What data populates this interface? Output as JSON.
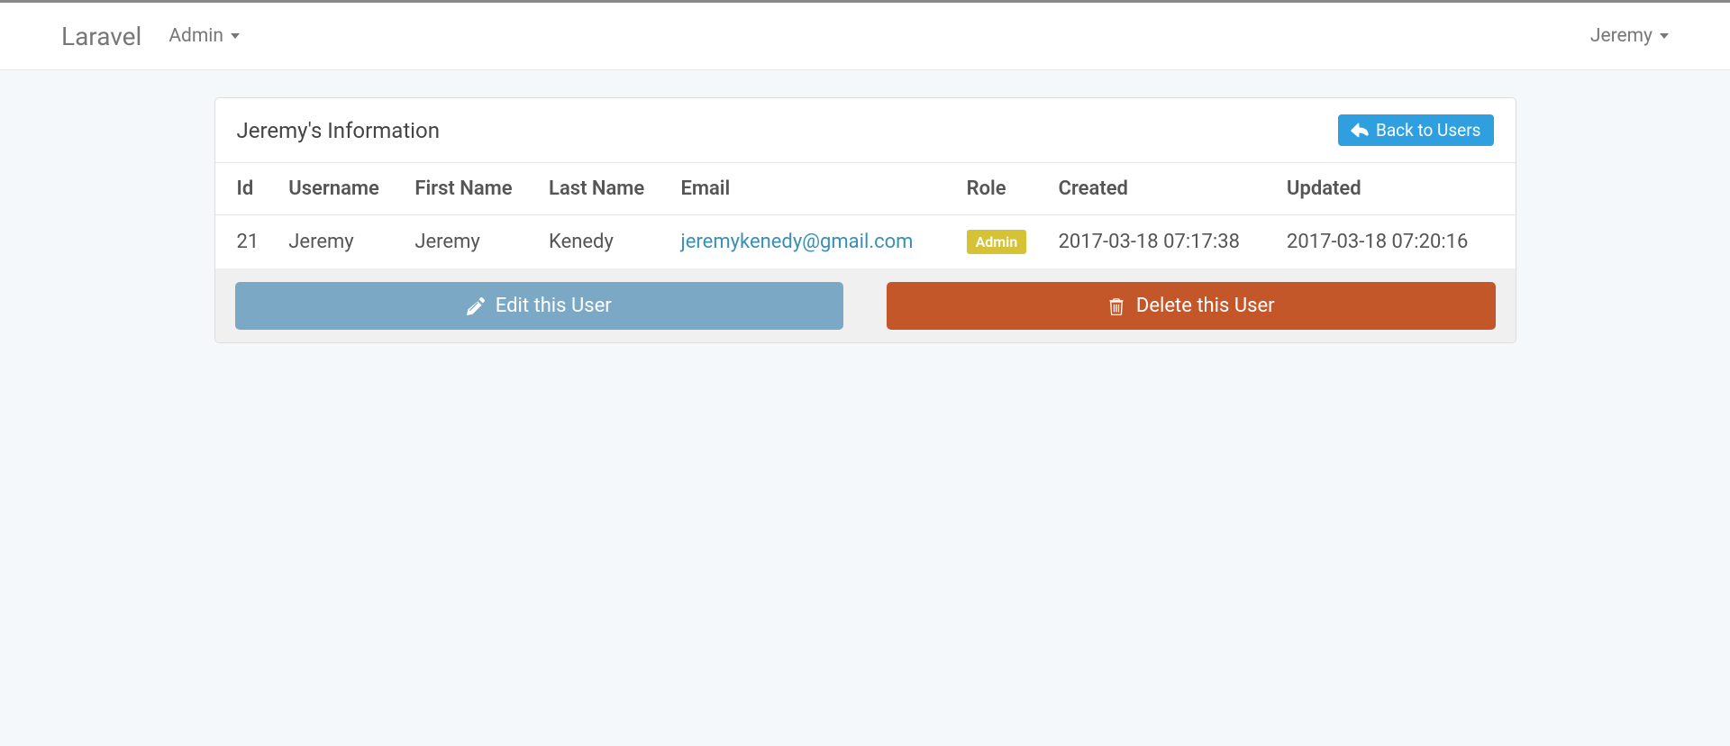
{
  "navbar": {
    "brand": "Laravel",
    "admin_label": "Admin",
    "user_label": "Jeremy"
  },
  "panel": {
    "title": "Jeremy's Information",
    "back_button": "Back to Users"
  },
  "table": {
    "headers": {
      "id": "Id",
      "username": "Username",
      "first_name": "First Name",
      "last_name": "Last Name",
      "email": "Email",
      "role": "Role",
      "created": "Created",
      "updated": "Updated"
    },
    "row": {
      "id": "21",
      "username": "Jeremy",
      "first_name": "Jeremy",
      "last_name": "Kenedy",
      "email": "jeremykenedy@gmail.com",
      "role": "Admin",
      "created": "2017-03-18 07:17:38",
      "updated": "2017-03-18 07:20:16"
    }
  },
  "actions": {
    "edit": "Edit this User",
    "delete": "Delete this User"
  }
}
